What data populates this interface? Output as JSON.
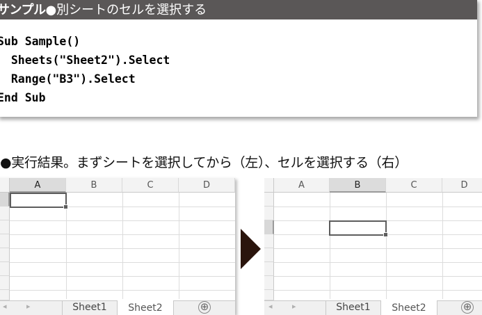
{
  "sample": {
    "label": "サンプル",
    "title": "●別シートのセルを選択する",
    "code": [
      "Sub Sample()",
      "  Sheets(\"Sheet2\").Select",
      "  Range(\"B3\").Select",
      "End Sub"
    ]
  },
  "result_title": "●実行結果。まずシートを選択してから（左）、セルを選択する（右）",
  "left_sheet": {
    "columns": [
      "A",
      "B",
      "C",
      "D"
    ],
    "selected_column": "A",
    "active_cell": "A1",
    "tabs": [
      "Sheet1",
      "Sheet2"
    ],
    "active_tab": "Sheet2",
    "add_sheet_icon": "⊕"
  },
  "right_sheet": {
    "columns": [
      "A",
      "B",
      "C",
      "D"
    ],
    "selected_column": "B",
    "active_cell": "B3",
    "tabs": [
      "Sheet1",
      "Sheet2"
    ],
    "active_tab": "Sheet2",
    "add_sheet_icon": "⊕"
  }
}
